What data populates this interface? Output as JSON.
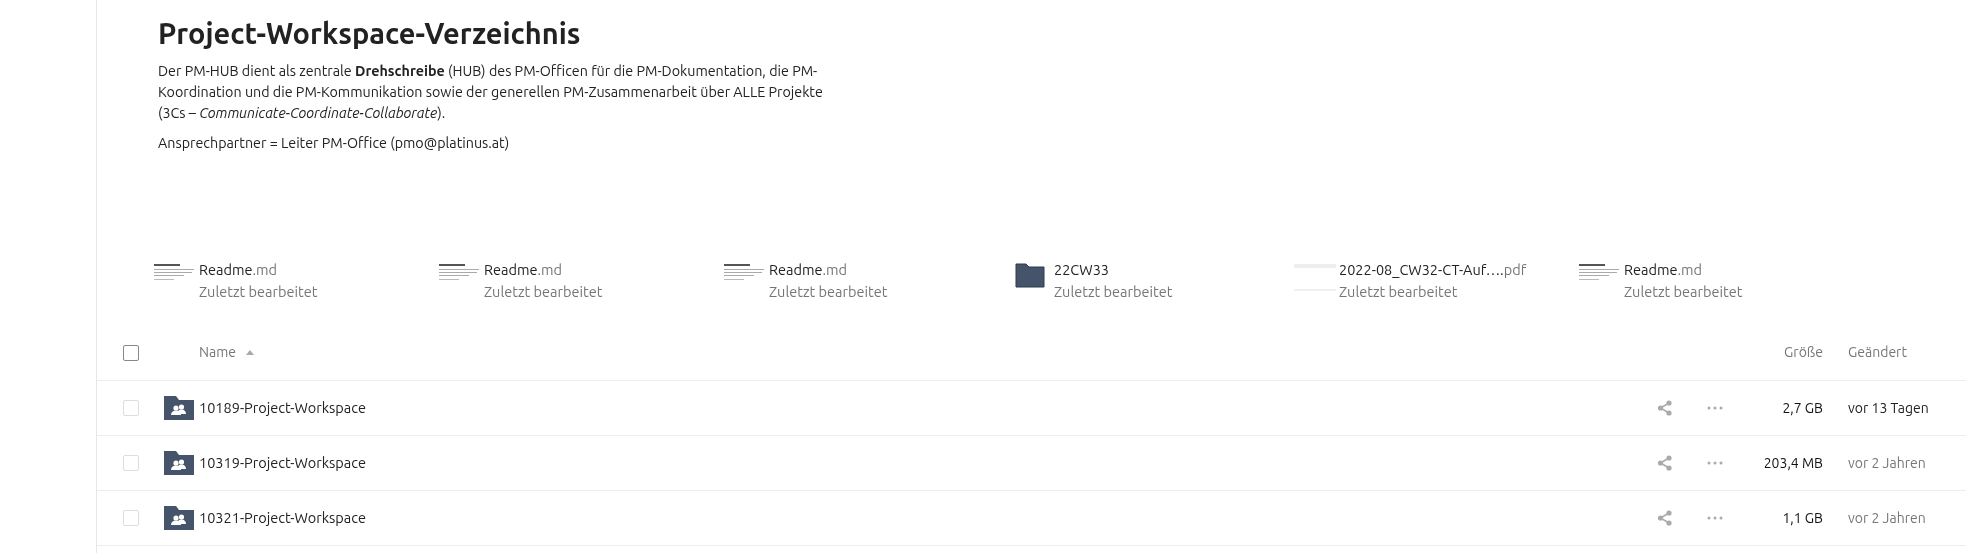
{
  "header": {
    "title": "Project-Workspace-Verzeichnis",
    "paragraphs": [
      "Der PM-HUB dient als zentrale **Drehschreibe** (HUB) des PM-Officen für die PM-Dokumentation, die PM-Koordination und die PM-Kommunikation sowie der generellen PM-Zusammenarbeit über ALLE Projekte (3Cs – *Communicate-Coordinate-Collaborate*).",
      "Ansprechpartner = Leiter PM-Office (pmo@platinus.at)"
    ]
  },
  "recent": [
    {
      "kind": "document",
      "name": "Readme",
      "ext": ".md",
      "subtitle": "Zuletzt bearbeitet"
    },
    {
      "kind": "document",
      "name": "Readme",
      "ext": ".md",
      "subtitle": "Zuletzt bearbeitet"
    },
    {
      "kind": "document",
      "name": "Readme",
      "ext": ".md",
      "subtitle": "Zuletzt bearbeitet"
    },
    {
      "kind": "folder",
      "name": "22CW33",
      "subtitle": "Zuletzt bearbeitet"
    },
    {
      "kind": "pdf",
      "name": "2022-08_CW32-CT-Auf….",
      "ext": "pdf",
      "subtitle": "Zuletzt bearbeitet"
    },
    {
      "kind": "document",
      "name": "Readme",
      "ext": ".md",
      "subtitle": "Zuletzt bearbeitet"
    }
  ],
  "table": {
    "select_all": {
      "checked": false
    },
    "columns": [
      {
        "label": "Name",
        "sorted": true
      },
      {
        "label": "Größe",
        "sorted": false
      },
      {
        "label": "Geändert",
        "sorted": false
      }
    ],
    "rows": [
      {
        "name": "10189-Project-Workspace",
        "size": "2,7 GB",
        "modified": "vor 13 Tagen",
        "recent": true,
        "checked": false
      },
      {
        "name": "10319-Project-Workspace",
        "size": "203,4 MB",
        "modified": "vor 2 Jahren",
        "recent": false,
        "checked": false
      },
      {
        "name": "10321-Project-Workspace",
        "size": "1,1 GB",
        "modified": "vor 2 Jahren",
        "recent": false,
        "checked": false
      }
    ]
  }
}
